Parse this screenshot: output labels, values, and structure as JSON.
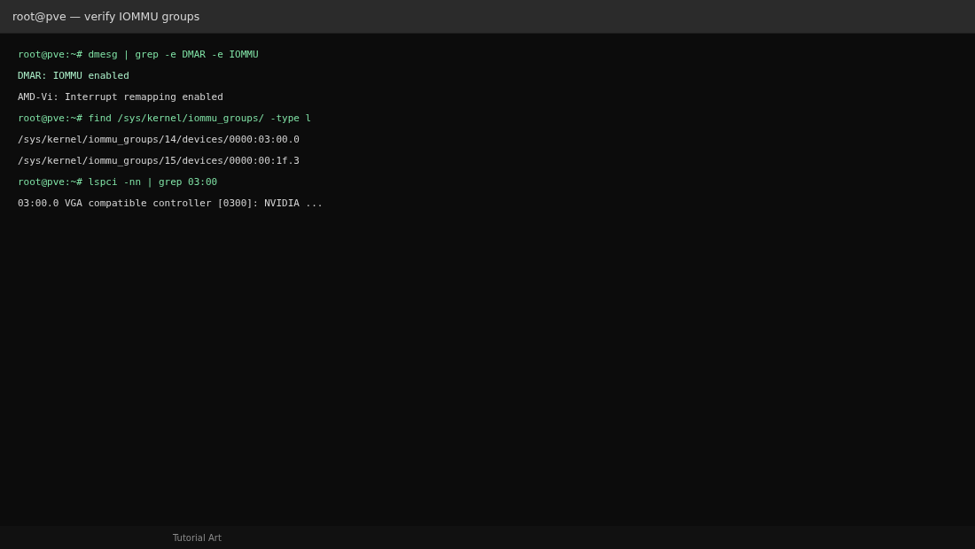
{
  "window": {
    "title": "root@pve — verify IOMMU groups"
  },
  "terminal": {
    "lines": [
      {
        "kind": "command",
        "text": "root@pve:~# dmesg | grep -e DMAR -e IOMMU"
      },
      {
        "kind": "highlight",
        "text": "DMAR: IOMMU enabled"
      },
      {
        "kind": "output",
        "text": "AMD-Vi: Interrupt remapping enabled"
      },
      {
        "kind": "command",
        "text": "root@pve:~# find /sys/kernel/iommu_groups/ -type l"
      },
      {
        "kind": "output",
        "text": "/sys/kernel/iommu_groups/14/devices/0000:03:00.0"
      },
      {
        "kind": "output",
        "text": "/sys/kernel/iommu_groups/15/devices/0000:00:1f.3"
      },
      {
        "kind": "command",
        "text": "root@pve:~# lspci -nn | grep 03:00"
      },
      {
        "kind": "output",
        "text": "03:00.0 VGA compatible controller [0300]: NVIDIA ..."
      }
    ]
  },
  "status_bar": {
    "text": "Tutorial Art"
  }
}
